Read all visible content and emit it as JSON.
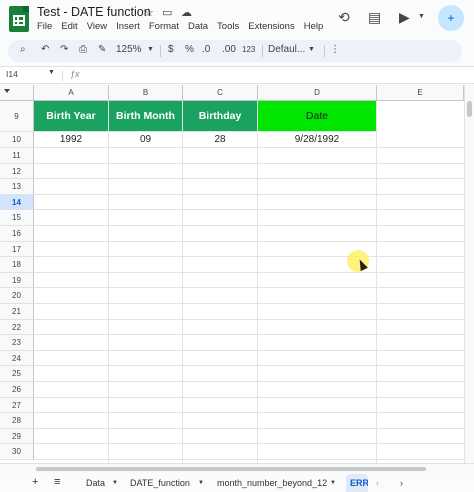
{
  "app": {
    "doc_title": "Test - DATE function",
    "menu": [
      "File",
      "Edit",
      "View",
      "Insert",
      "Format",
      "Data",
      "Tools",
      "Extensions",
      "Help"
    ]
  },
  "toolbar": {
    "zoom": "125%",
    "currency": "$",
    "percent": "%",
    "decrease_decimal": ".0",
    "increase_decimal": ".00",
    "number_format": "123",
    "font": "Defaul..."
  },
  "namebox": {
    "cell_ref": "I14"
  },
  "grid": {
    "columns": [
      "A",
      "B",
      "C",
      "D",
      "E"
    ],
    "rows": [
      "9",
      "10",
      "11",
      "12",
      "13",
      "14",
      "15",
      "16",
      "17",
      "18",
      "19",
      "20",
      "21",
      "22",
      "23",
      "24",
      "25",
      "26",
      "27",
      "28",
      "29",
      "30"
    ],
    "active_row": "14",
    "header_row": [
      "Birth Year",
      "Birth Month",
      "Birthday",
      "Date"
    ],
    "data_row": [
      "1992",
      "09",
      "28",
      "9/28/1992"
    ]
  },
  "sheet_tabs": {
    "add": "+",
    "list": "≡",
    "tabs": [
      "Data",
      "DATE_function",
      "month_number_beyond_12",
      "ERR"
    ],
    "active": "ERR"
  },
  "colors": {
    "header_green": "#1aa260",
    "date_green": "#00e600",
    "accent": "#0b57d0"
  }
}
